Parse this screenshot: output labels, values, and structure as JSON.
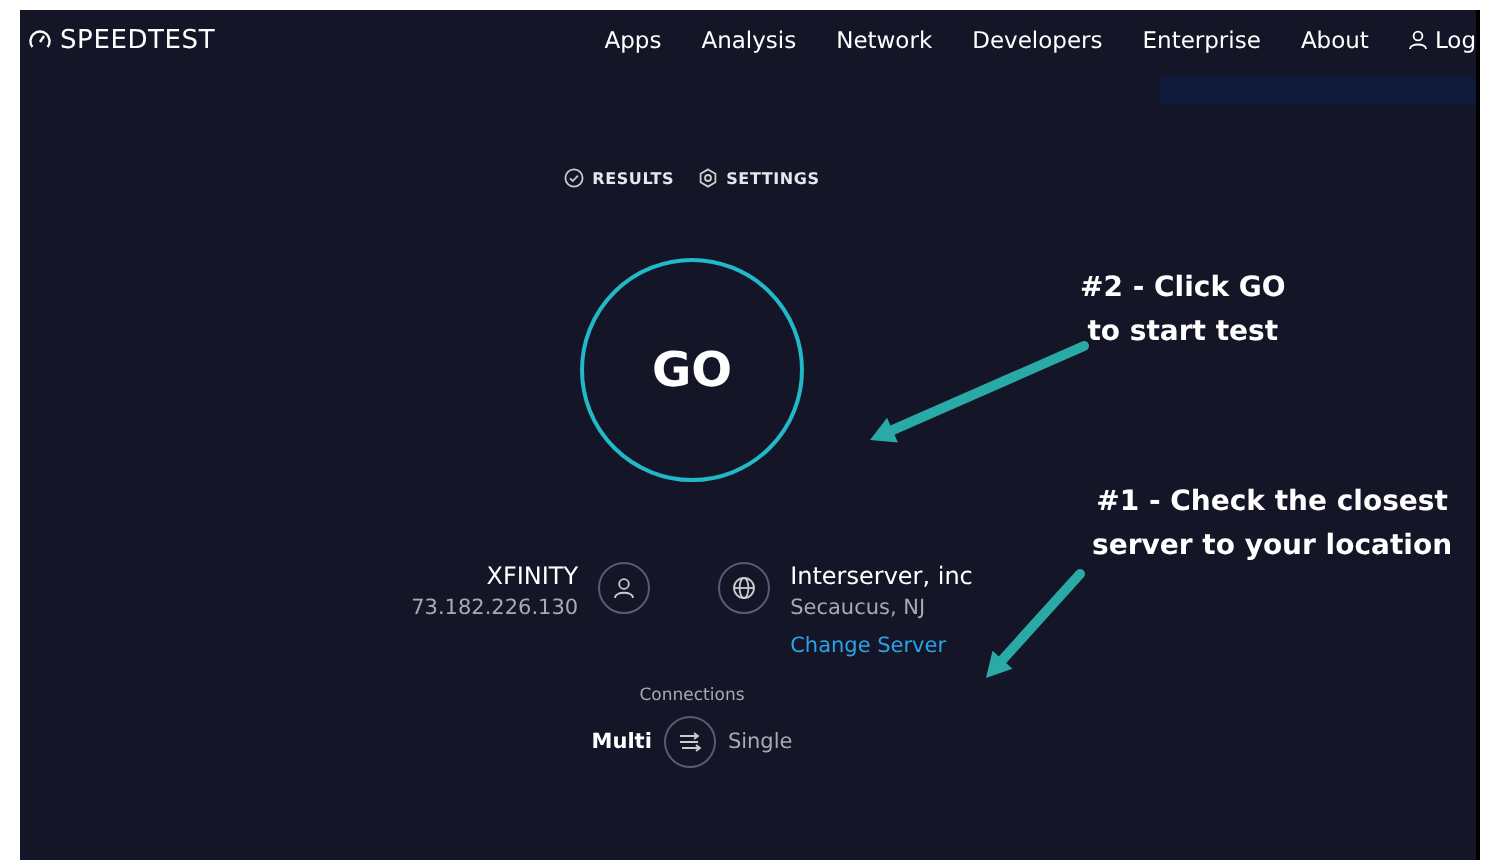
{
  "header": {
    "logo": "SPEEDTEST",
    "nav": [
      {
        "label": "Apps"
      },
      {
        "label": "Analysis"
      },
      {
        "label": "Network"
      },
      {
        "label": "Developers"
      },
      {
        "label": "Enterprise"
      },
      {
        "label": "About"
      }
    ],
    "login": "Log"
  },
  "tabs": [
    {
      "label": "RESULTS",
      "kind": "results"
    },
    {
      "label": "SETTINGS",
      "kind": "settings"
    }
  ],
  "go_button": "GO",
  "provider": {
    "name": "XFINITY",
    "ip": "73.182.226.130"
  },
  "server": {
    "name": "Interserver, inc",
    "location": "Secaucus, NJ",
    "link": "Change Server"
  },
  "connections": {
    "label": "Connections",
    "options": [
      {
        "label": "Multi",
        "selected": true
      },
      {
        "label": "Single",
        "selected": false
      }
    ]
  },
  "annotations": [
    {
      "lines": [
        "#2 - Click GO",
        "to start test"
      ],
      "kind": "go"
    },
    {
      "lines": [
        "#1 - Check the closest",
        "server to your location"
      ],
      "kind": "server"
    }
  ]
}
